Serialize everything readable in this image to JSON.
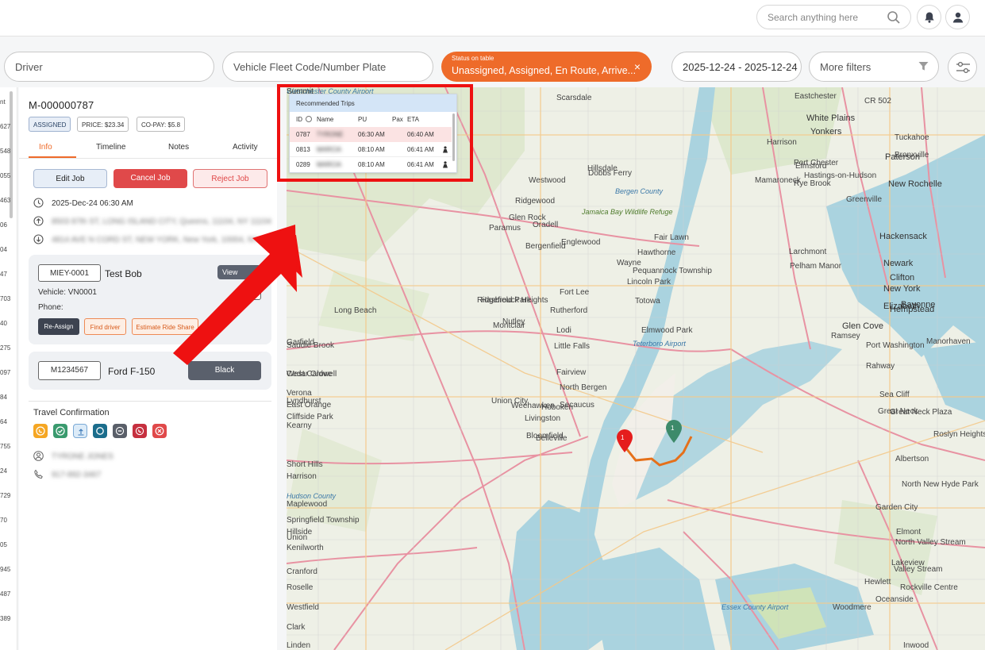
{
  "header": {
    "search_placeholder": "Search anything here",
    "icons": [
      "search-icon",
      "bell-icon",
      "user-icon"
    ]
  },
  "filters": {
    "driver": "Driver",
    "vehicle": "Vehicle Fleet Code/Number Plate",
    "status_label": "Status on table",
    "status_value": "Unassigned, Assigned, En Route, Arrive...",
    "status_clear": "×",
    "date_range": "2025-12-24 - 2025-12-24",
    "more_filters": "More filters"
  },
  "slim_column": [
    "nt",
    "627",
    "548",
    "055",
    "463",
    "06",
    "04",
    "47",
    "703",
    "40",
    "275",
    "097",
    "84",
    "64",
    "755",
    "24",
    "729",
    "70",
    "05",
    "945",
    "487",
    "389"
  ],
  "job": {
    "id": "M-000000787",
    "status": "ASSIGNED",
    "price": "PRICE: $23.34",
    "copay": "CO-PAY: $5.8",
    "tabs": [
      "Info",
      "Timeline",
      "Notes",
      "Activity"
    ],
    "actions": {
      "edit": "Edit Job",
      "cancel": "Cancel Job",
      "reject": "Reject Job"
    },
    "pickup_time": "2025-Dec-24 06:30 AM",
    "pickup_address": "8503 87th ST, LONG ISLAND CITY, Queens, 11104, NY 11104",
    "dropoff_address": "4814 AVE N CORD ST, NEW YORK, New York, 10004, NY"
  },
  "driver": {
    "code": "MIEY-0001",
    "name": "Test Bob",
    "view_label": "View",
    "vehicle_label": "Vehicle: VN0001",
    "phone_label": "Phone:",
    "reassign": "Re-Assign",
    "find_driver": "Find driver",
    "estimate": "Estimate Ride Share"
  },
  "vehicle": {
    "plate": "M1234567",
    "model": "Ford F-150",
    "color_label": "Black"
  },
  "travel": {
    "title": "Travel Confirmation",
    "icon_colors": [
      "#f5a623",
      "#3a9a6e",
      "#dcebf8",
      "#1b6d8c",
      "#5a5f69",
      "#c6303f",
      "#e0494a"
    ],
    "passenger_name": "TYRONE JONES",
    "passenger_phone": "917-892-3467"
  },
  "recommended": {
    "title": "Recommended Trips",
    "columns": [
      "ID",
      "Name",
      "PU",
      "Pax",
      "ETA"
    ],
    "rows": [
      {
        "id": "0787",
        "name": "TYRONE",
        "pu": "06:30 AM",
        "eta": "06:40 AM"
      },
      {
        "id": "0813",
        "name": "MARCIA",
        "pu": "08:10 AM",
        "eta": "06:41 AM"
      },
      {
        "id": "0289",
        "name": "MARCIA",
        "pu": "08:10 AM",
        "eta": "06:41 AM"
      }
    ]
  },
  "map": {
    "labels": [
      {
        "text": "White Plains",
        "cls": "big"
      },
      {
        "text": "Yonkers",
        "cls": "big"
      },
      {
        "text": "New Rochelle",
        "cls": "big"
      },
      {
        "text": "Paterson",
        "cls": "big"
      },
      {
        "text": "Hackensack",
        "cls": "big"
      },
      {
        "text": "Clifton",
        "cls": "big"
      },
      {
        "text": "Newark",
        "cls": "big"
      },
      {
        "text": "New York",
        "cls": "big"
      },
      {
        "text": "Elizabeth",
        "cls": "big"
      },
      {
        "text": "Bayonne",
        "cls": "big"
      },
      {
        "text": "Hempstead",
        "cls": "big"
      },
      {
        "text": "Glen Cove",
        "cls": "big"
      },
      {
        "text": "Ramsey",
        "cls": ""
      },
      {
        "text": "Elmsford",
        "cls": ""
      },
      {
        "text": "Rye Brook",
        "cls": ""
      },
      {
        "text": "Port Chester",
        "cls": ""
      },
      {
        "text": "Harrison",
        "cls": ""
      },
      {
        "text": "Mamaroneck",
        "cls": ""
      },
      {
        "text": "Scarsdale",
        "cls": ""
      },
      {
        "text": "Eastchester",
        "cls": ""
      },
      {
        "text": "Tuckahoe",
        "cls": ""
      },
      {
        "text": "Bronxville",
        "cls": ""
      },
      {
        "text": "Larchmont",
        "cls": ""
      },
      {
        "text": "Pelham Manor",
        "cls": ""
      },
      {
        "text": "Greenville",
        "cls": ""
      },
      {
        "text": "Hastings-on-Hudson",
        "cls": ""
      },
      {
        "text": "Dobbs Ferry",
        "cls": ""
      },
      {
        "text": "Hillsdale",
        "cls": ""
      },
      {
        "text": "Westwood",
        "cls": ""
      },
      {
        "text": "Ridgewood",
        "cls": ""
      },
      {
        "text": "Glen Rock",
        "cls": ""
      },
      {
        "text": "Paramus",
        "cls": ""
      },
      {
        "text": "Oradell",
        "cls": ""
      },
      {
        "text": "Bergenfield",
        "cls": ""
      },
      {
        "text": "Englewood",
        "cls": ""
      },
      {
        "text": "Fort Lee",
        "cls": ""
      },
      {
        "text": "Hawthorne",
        "cls": ""
      },
      {
        "text": "Fair Lawn",
        "cls": ""
      },
      {
        "text": "Wayne",
        "cls": ""
      },
      {
        "text": "Pequannock Township",
        "cls": ""
      },
      {
        "text": "Lincoln Park",
        "cls": ""
      },
      {
        "text": "Totowa",
        "cls": ""
      },
      {
        "text": "Elmwood Park",
        "cls": ""
      },
      {
        "text": "Saddle Brook",
        "cls": ""
      },
      {
        "text": "Garfield",
        "cls": ""
      },
      {
        "text": "Lodi",
        "cls": ""
      },
      {
        "text": "Little Falls",
        "cls": ""
      },
      {
        "text": "Hasbrouck Heights",
        "cls": ""
      },
      {
        "text": "Ridgefield Park",
        "cls": ""
      },
      {
        "text": "Cedar Grove",
        "cls": ""
      },
      {
        "text": "West Caldwell",
        "cls": ""
      },
      {
        "text": "Verona",
        "cls": ""
      },
      {
        "text": "Montclair",
        "cls": ""
      },
      {
        "text": "Nutley",
        "cls": ""
      },
      {
        "text": "Rutherford",
        "cls": ""
      },
      {
        "text": "Lyndhurst",
        "cls": ""
      },
      {
        "text": "Cliffside Park",
        "cls": ""
      },
      {
        "text": "Fairview",
        "cls": ""
      },
      {
        "text": "North Bergen",
        "cls": ""
      },
      {
        "text": "Secaucus",
        "cls": ""
      },
      {
        "text": "Union City",
        "cls": ""
      },
      {
        "text": "Weehawken",
        "cls": ""
      },
      {
        "text": "Hoboken",
        "cls": ""
      },
      {
        "text": "Livingston",
        "cls": ""
      },
      {
        "text": "Bloomfield",
        "cls": ""
      },
      {
        "text": "Belleville",
        "cls": ""
      },
      {
        "text": "East Orange",
        "cls": ""
      },
      {
        "text": "Kearny",
        "cls": ""
      },
      {
        "text": "Harrison",
        "cls": ""
      },
      {
        "text": "Short Hills",
        "cls": ""
      },
      {
        "text": "Maplewood",
        "cls": ""
      },
      {
        "text": "Springfield Township",
        "cls": ""
      },
      {
        "text": "Union",
        "cls": ""
      },
      {
        "text": "Hillside",
        "cls": ""
      },
      {
        "text": "Kenilworth",
        "cls": ""
      },
      {
        "text": "Cranford",
        "cls": ""
      },
      {
        "text": "Roselle",
        "cls": ""
      },
      {
        "text": "Westfield",
        "cls": ""
      },
      {
        "text": "Clark",
        "cls": ""
      },
      {
        "text": "Linden",
        "cls": ""
      },
      {
        "text": "Rahway",
        "cls": ""
      },
      {
        "text": "Port Washington",
        "cls": ""
      },
      {
        "text": "Manorhaven",
        "cls": ""
      },
      {
        "text": "Sea Cliff",
        "cls": ""
      },
      {
        "text": "Great Neck",
        "cls": ""
      },
      {
        "text": "Great Neck Plaza",
        "cls": ""
      },
      {
        "text": "Roslyn Heights",
        "cls": ""
      },
      {
        "text": "Albertson",
        "cls": ""
      },
      {
        "text": "North New Hyde Park",
        "cls": ""
      },
      {
        "text": "Garden City",
        "cls": ""
      },
      {
        "text": "Elmont",
        "cls": ""
      },
      {
        "text": "North Valley Stream",
        "cls": ""
      },
      {
        "text": "Lakeview",
        "cls": ""
      },
      {
        "text": "Valley Stream",
        "cls": ""
      },
      {
        "text": "Rockville Centre",
        "cls": ""
      },
      {
        "text": "Hewlett",
        "cls": ""
      },
      {
        "text": "Oceanside",
        "cls": ""
      },
      {
        "text": "Woodmere",
        "cls": ""
      },
      {
        "text": "Inwood",
        "cls": ""
      },
      {
        "text": "Long Beach",
        "cls": ""
      },
      {
        "text": "Essex County Airport",
        "cls": "water"
      },
      {
        "text": "Jamaica Bay Wildlife Refuge",
        "cls": "park"
      },
      {
        "text": "Bergen County",
        "cls": "water"
      },
      {
        "text": "Teterboro Airport",
        "cls": "water"
      },
      {
        "text": "CR 502",
        "cls": ""
      },
      {
        "text": "Hudson County",
        "cls": "water"
      },
      {
        "text": "Westchester County Airport",
        "cls": "water"
      },
      {
        "text": "Summit",
        "cls": ""
      }
    ],
    "markers": [
      "1",
      "1"
    ]
  }
}
